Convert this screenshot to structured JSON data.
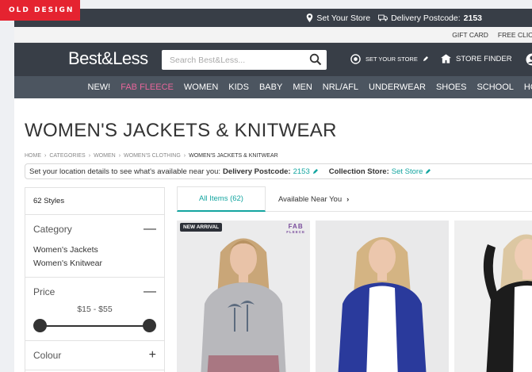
{
  "badge": "OLD DESIGN",
  "topbar": {
    "set_store": "Set Your Store",
    "delivery_label": "Delivery Postcode:",
    "delivery_value": "2153"
  },
  "links": [
    "GIFT CARD",
    "FREE CLICK"
  ],
  "header": {
    "logo": "Best&Less",
    "search_placeholder": "Search Best&Less...",
    "set_your_store": "SET YOUR STORE",
    "store_finder": "STORE FINDER"
  },
  "nav": [
    "NEW!",
    "FAB FLEECE",
    "WOMEN",
    "KIDS",
    "BABY",
    "MEN",
    "NRL/AFL",
    "UNDERWEAR",
    "SHOES",
    "SCHOOL",
    "HO"
  ],
  "page_title": "WOMEN'S JACKETS & KNITWEAR",
  "breadcrumb": [
    "HOME",
    "CATEGORIES",
    "WOMEN",
    "WOMEN'S CLOTHING",
    "WOMEN'S JACKETS & KNITWEAR"
  ],
  "location": {
    "prompt": "Set your location details to see what's available near you:",
    "postcode_label": "Delivery Postcode:",
    "postcode_value": "2153",
    "store_label": "Collection Store:",
    "store_value": "Set Store"
  },
  "sidebar": {
    "styles_count": "62 Styles",
    "category_title": "Category",
    "category_options": [
      "Women's Jackets",
      "Women's Knitwear"
    ],
    "price_title": "Price",
    "price_range": "$15 - $55",
    "colour_title": "Colour"
  },
  "tabs": {
    "all_items": "All Items (62)",
    "near_you": "Available Near You"
  },
  "products": [
    {
      "tag": "NEW ARRIVAL",
      "brand": "FAB",
      "brand_sub": "FLEECE",
      "color": "#b8b8bc"
    },
    {
      "color": "#2a3a9c"
    },
    {
      "color": "#1c1c1c"
    }
  ],
  "colors": {
    "dark_bar": "#383e47",
    "nav_bar": "#4c5560",
    "accent_teal": "#13a5a0",
    "fab_pink": "#e8669b",
    "badge_red": "#e52330"
  }
}
